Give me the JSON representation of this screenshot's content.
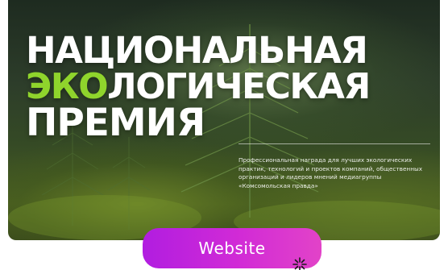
{
  "banner": {
    "headline": {
      "line1": "НАЦИОНАЛЬНАЯ",
      "line2_highlight": "ЭКО",
      "line2_rest": "ЛОГИЧЕСКАЯ",
      "line3": "ПРЕМИЯ"
    },
    "description": "Профессиональная награда для лучших экологических практик, технологий и проектов компаний, общественных организаций и лидеров мнений медиагруппы «Комсомольская правда»",
    "colors": {
      "headline": "#ffffff",
      "highlight": "#8fd42c"
    }
  },
  "cta": {
    "label": "Website",
    "colors": {
      "gradient_start": "#b11de0",
      "gradient_end": "#e243c8"
    }
  },
  "icons": {
    "cursor": "sparkle-cursor-icon"
  }
}
